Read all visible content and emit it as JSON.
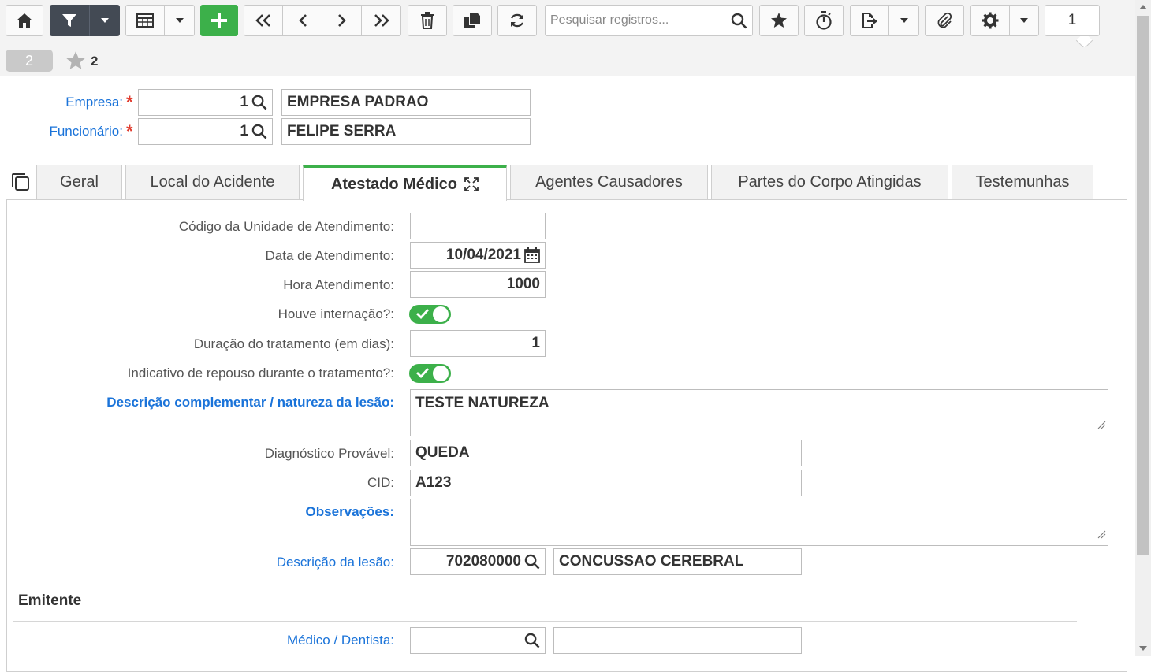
{
  "toolbar": {
    "search_placeholder": "Pesquisar registros...",
    "page_number": "1",
    "icons": [
      "home-icon",
      "filter-icon",
      "chevron-down-icon",
      "grid-icon",
      "plus-icon",
      "first-page-icon",
      "prev-icon",
      "next-icon",
      "last-page-icon",
      "trash-icon",
      "copy-icon",
      "refresh-icon",
      "search-icon",
      "star-icon",
      "stopwatch-icon",
      "export-icon",
      "paperclip-icon",
      "gear-icon"
    ]
  },
  "subbar": {
    "record_count": "2",
    "favorites_count": "2"
  },
  "header": {
    "empresa": {
      "label": "Empresa:",
      "code": "1",
      "name": "EMPRESA PADRAO"
    },
    "funcionario": {
      "label": "Funcionário:",
      "code": "1",
      "name": "FELIPE SERRA"
    },
    "required_mark": "*"
  },
  "tabs": [
    {
      "label": "Geral"
    },
    {
      "label": "Local do Acidente"
    },
    {
      "label": "Atestado Médico",
      "active": true
    },
    {
      "label": "Agentes Causadores"
    },
    {
      "label": "Partes do Corpo Atingidas"
    },
    {
      "label": "Testemunhas"
    }
  ],
  "form": {
    "codigo_unidade": {
      "label": "Código da Unidade de Atendimento:",
      "value": ""
    },
    "data_atendimento": {
      "label": "Data de Atendimento:",
      "value": "10/04/2021"
    },
    "hora_atendimento": {
      "label": "Hora Atendimento:",
      "value": "1000"
    },
    "houve_internacao": {
      "label": "Houve internação?:",
      "checked": true
    },
    "duracao_tratamento": {
      "label": "Duração do tratamento (em dias):",
      "value": "1"
    },
    "indicativo_repouso": {
      "label": "Indicativo de repouso durante o tratamento?:",
      "checked": true
    },
    "descricao_complementar": {
      "label": "Descrição complementar / natureza da lesão:",
      "value": "TESTE NATUREZA"
    },
    "diagnostico": {
      "label": "Diagnóstico Provável:",
      "value": "QUEDA"
    },
    "cid": {
      "label": "CID:",
      "value": "A123"
    },
    "observacoes": {
      "label": "Observações:",
      "value": ""
    },
    "descricao_lesao": {
      "label": "Descrição da lesão:",
      "code": "702080000",
      "name": "CONCUSSAO CEREBRAL"
    }
  },
  "emitente": {
    "title": "Emitente",
    "medico": {
      "label": "Médico / Dentista:",
      "code": "",
      "name": ""
    }
  },
  "colors": {
    "accent_green": "#3cb04a",
    "link_blue": "#1a73d9",
    "required_red": "#e03b2e",
    "dark_button": "#434a54"
  }
}
